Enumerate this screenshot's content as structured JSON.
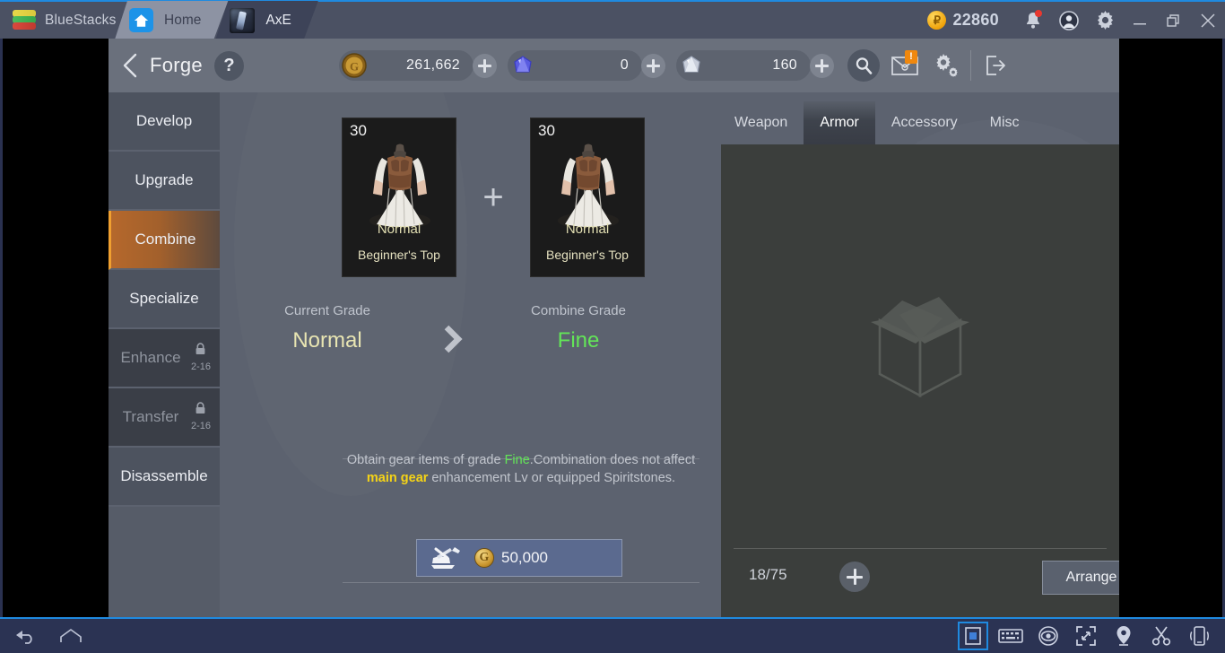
{
  "titlebar": {
    "app_name": "BlueStacks",
    "logo_icon": "bluestacks-logo-icon",
    "tabs": [
      {
        "label": "Home",
        "icon": "home-icon",
        "active": false
      },
      {
        "label": "AxE",
        "icon": "axe-game-icon",
        "active": true
      }
    ],
    "points_icon": "points-coin-icon",
    "points_value": "22860",
    "notification_icon": "bell-icon",
    "account_icon": "user-account-icon",
    "settings_icon": "gear-icon",
    "minimize_icon": "minimize-icon",
    "maximize_icon": "restore-icon",
    "close_icon": "close-icon"
  },
  "game_header": {
    "back_icon": "back-chevron-icon",
    "title": "Forge",
    "help_label": "?",
    "currencies": [
      {
        "icon": "gold-coin-icon",
        "value": "261,662",
        "add_label": "+"
      },
      {
        "icon": "blue-gem-icon",
        "value": "0",
        "add_label": "+"
      },
      {
        "icon": "white-crystal-icon",
        "value": "160",
        "add_label": "+"
      }
    ],
    "search_icon": "search-icon",
    "mail_icon": "mail-icon",
    "mail_badge": "!",
    "settings_icon": "settings-gear-icon",
    "exit_icon": "exit-icon"
  },
  "sidebar": {
    "items": [
      {
        "label": "Develop",
        "state": "normal"
      },
      {
        "label": "Upgrade",
        "state": "normal"
      },
      {
        "label": "Combine",
        "state": "active"
      },
      {
        "label": "Specialize",
        "state": "normal"
      },
      {
        "label": "Enhance",
        "state": "locked",
        "lock_level": "2-16",
        "lock_icon": "lock-icon"
      },
      {
        "label": "Transfer",
        "state": "locked",
        "lock_level": "2-16",
        "lock_icon": "lock-icon"
      },
      {
        "label": "Disassemble",
        "state": "normal"
      }
    ]
  },
  "combine": {
    "item_a": {
      "level": "30",
      "grade": "Normal",
      "name": "Beginner's Top",
      "icon": "armor-top-icon"
    },
    "plus_symbol": "+",
    "item_b": {
      "level": "30",
      "grade": "Normal",
      "name": "Beginner's Top",
      "icon": "armor-top-icon"
    },
    "current_grade_label": "Current Grade",
    "current_grade_value": "Normal",
    "arrow_icon": "chevron-right-icon",
    "combine_grade_label": "Combine Grade",
    "combine_grade_value": "Fine",
    "description": {
      "part1": "Obtain gear items of grade ",
      "highlight_grade": "Fine",
      "part2": ".Combination does not affect ",
      "highlight_gear": "main gear",
      "part3": " enhancement Lv or equipped Spiritstones."
    },
    "button": {
      "icon": "anvil-hammer-icon",
      "currency_icon": "gold-coin-icon",
      "cost": "50,000"
    }
  },
  "inventory": {
    "tabs": [
      {
        "label": "Weapon",
        "active": false
      },
      {
        "label": "Armor",
        "active": true
      },
      {
        "label": "Accessory",
        "active": false
      },
      {
        "label": "Misc",
        "active": false
      }
    ],
    "empty_icon": "empty-box-icon",
    "count": "18/75",
    "add_slots_label": "+",
    "arrange_label": "Arrange"
  },
  "bottombar": {
    "left_icons": [
      {
        "name": "back-icon"
      },
      {
        "name": "home-icon"
      }
    ],
    "right_icons": [
      {
        "name": "sidebar-toggle-icon",
        "selected": true
      },
      {
        "name": "keyboard-icon",
        "selected": false
      },
      {
        "name": "eye-icon",
        "selected": false
      },
      {
        "name": "fullscreen-icon",
        "selected": false
      },
      {
        "name": "location-pin-icon",
        "selected": false
      },
      {
        "name": "scissors-icon",
        "selected": false
      },
      {
        "name": "shake-device-icon",
        "selected": false
      }
    ]
  },
  "colors": {
    "accent_blue": "#1f8ae0",
    "title_bg": "#4b5163",
    "game_bg": "#5c626f",
    "active_menu": "#b5682c",
    "grade_next": "#63e558",
    "grade_current": "#e8e5b2",
    "highlight_yellow": "#f6d416"
  }
}
